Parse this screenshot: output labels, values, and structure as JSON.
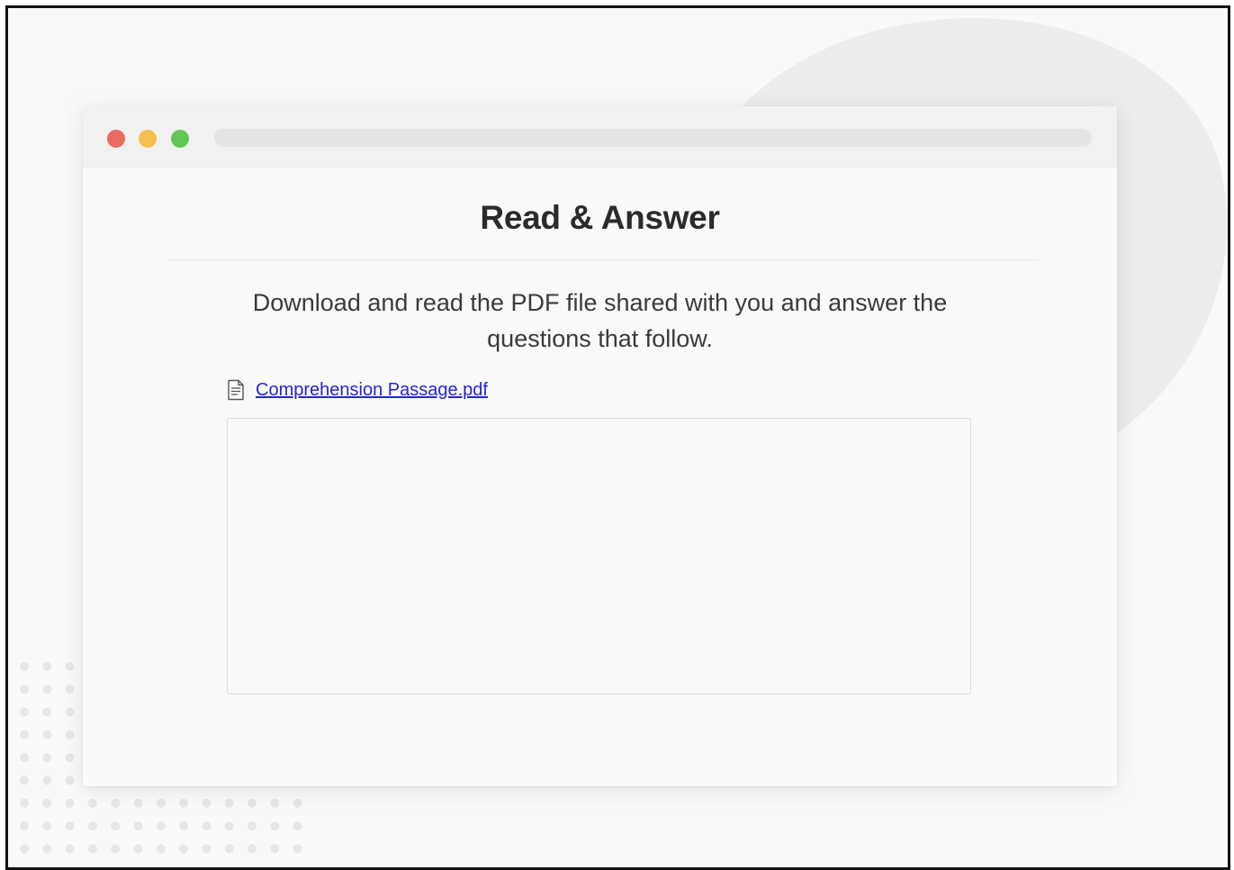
{
  "window": {
    "traffic_lights": [
      {
        "name": "close",
        "color": "#ec6b60"
      },
      {
        "name": "minimize",
        "color": "#f5c04f"
      },
      {
        "name": "maximize",
        "color": "#62c655"
      }
    ]
  },
  "page": {
    "title": "Read & Answer",
    "description": "Download and read the PDF file shared with you and answer the questions that follow.",
    "attachment": {
      "icon": "document-icon",
      "label": "Comprehension Passage.pdf"
    },
    "answer_box": {
      "value": ""
    }
  },
  "colors": {
    "link": "#2424d9",
    "heading": "#2b2b2b",
    "body_text": "#3a3a3a"
  }
}
